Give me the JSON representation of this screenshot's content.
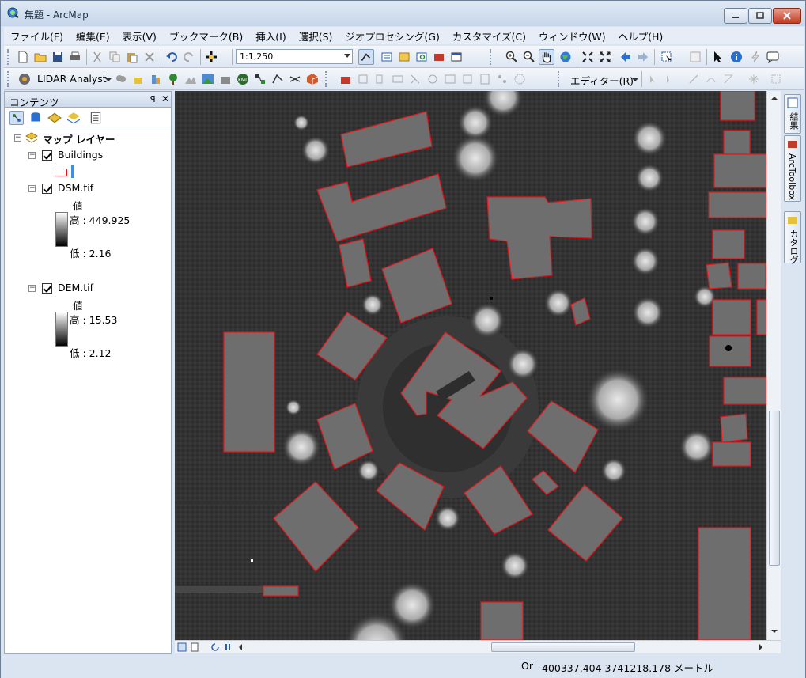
{
  "window": {
    "title": "無題 - ArcMap"
  },
  "menu": [
    "ファイル(F)",
    "編集(E)",
    "表示(V)",
    "ブックマーク(B)",
    "挿入(I)",
    "選択(S)",
    "ジオプロセシング(G)",
    "カスタマイズ(C)",
    "ウィンドウ(W)",
    "ヘルプ(H)"
  ],
  "toolbar": {
    "scale": "1:1,250",
    "lidar": "LIDAR Analyst",
    "editor": "エディター(R)"
  },
  "toc": {
    "title": "コンテンツ",
    "pin": "ꟼ",
    "close": "✕",
    "root": "マップ レイヤー",
    "buildings": "Buildings",
    "dsm": {
      "name": "DSM.tif",
      "value_label": "値",
      "high": "高 : 449.925",
      "low": "低 : 2.16"
    },
    "dem": {
      "name": "DEM.tif",
      "value_label": "値",
      "high": "高 : 15.53",
      "low": "低 : 2.12"
    }
  },
  "dock": {
    "results": "結果",
    "arctoolbox": "ArcToolbox",
    "catalog": "カタログ"
  },
  "status": {
    "coords": "400337.404  3741218.178 メートル",
    "prefix": "Or"
  },
  "colors": {
    "building_outline": "#e8141a",
    "legend_line": "#3c8fe6"
  }
}
